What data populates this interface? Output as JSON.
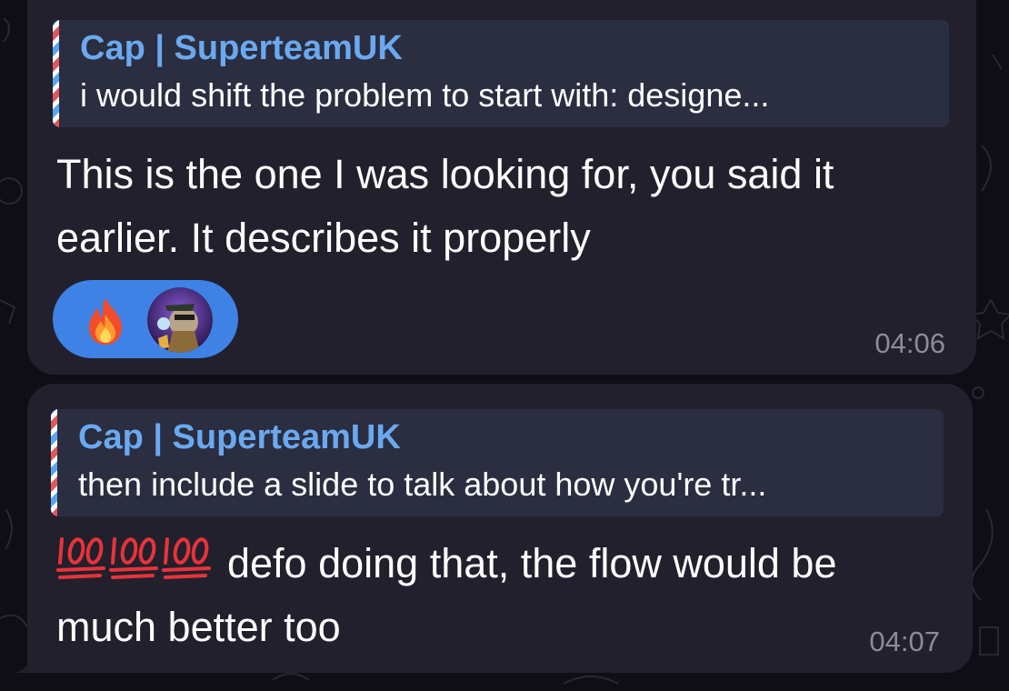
{
  "messages": [
    {
      "reply": {
        "author": "Cap | SuperteamUK",
        "snippet": "i would shift the problem to start with: designe..."
      },
      "text": "This is the one I was looking for, you said it earlier. It describes it properly",
      "reactions": [
        "fire-emoji",
        "user-avatar"
      ],
      "time": "04:06"
    },
    {
      "reply": {
        "author": "Cap | SuperteamUK",
        "snippet": "then include a slide to talk about how you're tr..."
      },
      "emoji_prefix": [
        "100-emoji",
        "100-emoji",
        "100-emoji"
      ],
      "text": "defo doing that, the flow would be much better too",
      "time": "04:07"
    }
  ],
  "colors": {
    "background": "#0f0d15",
    "bubble": "#22202c",
    "reply_box": "#2b2d40",
    "reply_author": "#6aa9ef",
    "reaction_pill": "#3f82e6",
    "timestamp": "#8d8b97"
  }
}
